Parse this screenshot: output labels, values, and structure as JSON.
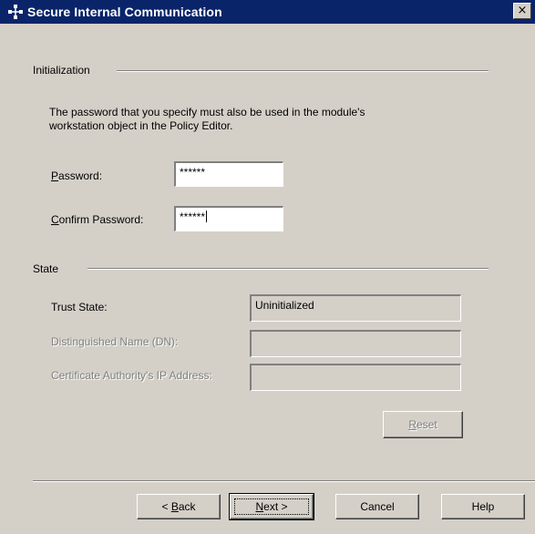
{
  "window": {
    "title": "Secure Internal Communication",
    "close_symbol": "×"
  },
  "initialization": {
    "group_label": "Initialization",
    "description_line1": "The password that you specify must also be used in the module's",
    "description_line2": "workstation object in the Policy Editor.",
    "password_label_mnemonic": "P",
    "password_label_rest": "assword:",
    "password_value": "******",
    "confirm_label_mnemonic": "C",
    "confirm_label_rest": "onfirm Password:",
    "confirm_value": "******"
  },
  "state": {
    "group_label": "State",
    "trust_state_label": "Trust State:",
    "trust_state_value": "Uninitialized",
    "dn_label": "Distinguished Name (DN):",
    "dn_value": "",
    "ca_ip_label": "Certificate Authority's IP Address:",
    "ca_ip_value": "",
    "reset_label_mnemonic": "R",
    "reset_label_rest": "eset"
  },
  "footer": {
    "back_prefix": "< ",
    "back_mnemonic": "B",
    "back_rest": "ack",
    "next_mnemonic": "N",
    "next_rest": "ext >",
    "cancel_label": "Cancel",
    "help_label": "Help"
  },
  "icons": {
    "title_icon": "network-tree-icon",
    "close_icon": "close-icon"
  }
}
